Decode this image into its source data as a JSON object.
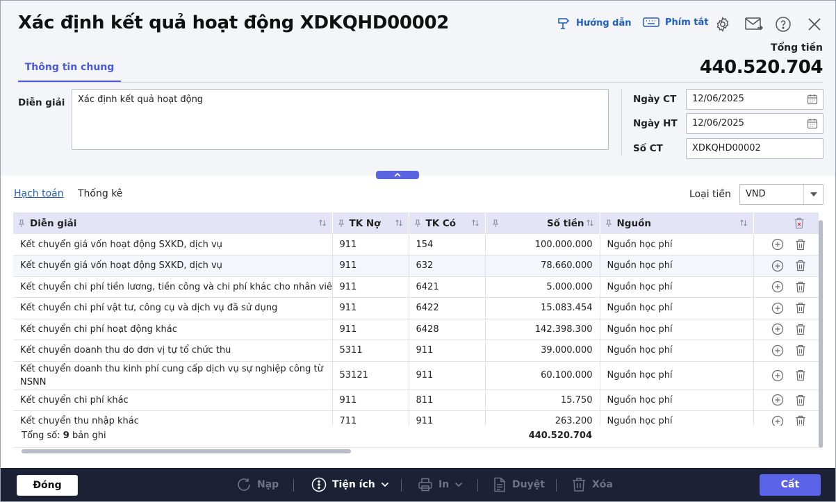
{
  "header": {
    "title": "Xác định kết quả hoạt động XDKQHD00002",
    "guide_label": "Hướng dẫn",
    "shortcut_label": "Phím tắt",
    "total_label": "Tổng tiền",
    "total_value": "440.520.704"
  },
  "tabs": {
    "general": "Thông tin chung"
  },
  "form": {
    "description_label": "Diễn giải",
    "description_value": "Xác định kết quả hoạt động",
    "date_ct_label": "Ngày CT",
    "date_ct_value": "12/06/2025",
    "date_ht_label": "Ngày HT",
    "date_ht_value": "12/06/2025",
    "so_ct_label": "Số CT",
    "so_ct_value": "XDKQHD00002"
  },
  "subtabs": {
    "accounting": "Hạch toán",
    "statistics": "Thống kê"
  },
  "currency": {
    "label": "Loại tiền",
    "value": "VND"
  },
  "grid": {
    "columns": [
      "Diễn giải",
      "TK Nợ",
      "TK Có",
      "Số tiền",
      "Nguồn"
    ],
    "rows": [
      {
        "desc": "Kết chuyển giá vốn hoạt động SXKD, dịch vụ",
        "debit": "911",
        "credit": "154",
        "amount": "100.000.000",
        "source": "Nguồn học phí"
      },
      {
        "desc": "Kết chuyển giá vốn hoạt động SXKD, dịch vụ",
        "debit": "911",
        "credit": "632",
        "amount": "78.660.000",
        "source": "Nguồn học phí"
      },
      {
        "desc": "Kết chuyển chi phí tiền lương, tiền công và chi phí khác cho nhân viên",
        "debit": "911",
        "credit": "6421",
        "amount": "5.000.000",
        "source": "Nguồn học phí"
      },
      {
        "desc": "Kết chuyển chi phí vật tư, công cụ và dịch vụ đã sử dụng",
        "debit": "911",
        "credit": "6422",
        "amount": "15.083.454",
        "source": "Nguồn học phí"
      },
      {
        "desc": "Kết chuyển chi phí hoạt động khác",
        "debit": "911",
        "credit": "6428",
        "amount": "142.398.300",
        "source": "Nguồn học phí"
      },
      {
        "desc": "Kết chuyển doanh thu do đơn vị tự tổ chức thu",
        "debit": "5311",
        "credit": "911",
        "amount": "39.000.000",
        "source": "Nguồn học phí"
      },
      {
        "desc": "Kết chuyển doanh thu kinh phí cung cấp dịch vụ sự nghiệp công từ NSNN",
        "debit": "53121",
        "credit": "911",
        "amount": "60.100.000",
        "source": "Nguồn học phí"
      },
      {
        "desc": "Kết chuyển chi phí khác",
        "debit": "911",
        "credit": "811",
        "amount": "15.750",
        "source": "Nguồn học phí"
      },
      {
        "desc": "Kết chuyển thu nhập khác",
        "debit": "711",
        "credit": "911",
        "amount": "263.200",
        "source": "Nguồn học phí"
      }
    ],
    "summary_prefix": "Tổng số: ",
    "summary_count": "9",
    "summary_suffix": " bản ghi",
    "summary_total": "440.520.704"
  },
  "footer": {
    "close_label": "Đóng",
    "reload_label": "Nạp",
    "utility_label": "Tiện ích",
    "print_label": "In",
    "approve_label": "Duyệt",
    "delete_label": "Xóa",
    "save_label": "Cất"
  },
  "colors": {
    "accent": "#5b64e8",
    "link": "#1f5fc4",
    "footer_bg": "#1d2136",
    "header_bg": "#e3e5f6"
  }
}
